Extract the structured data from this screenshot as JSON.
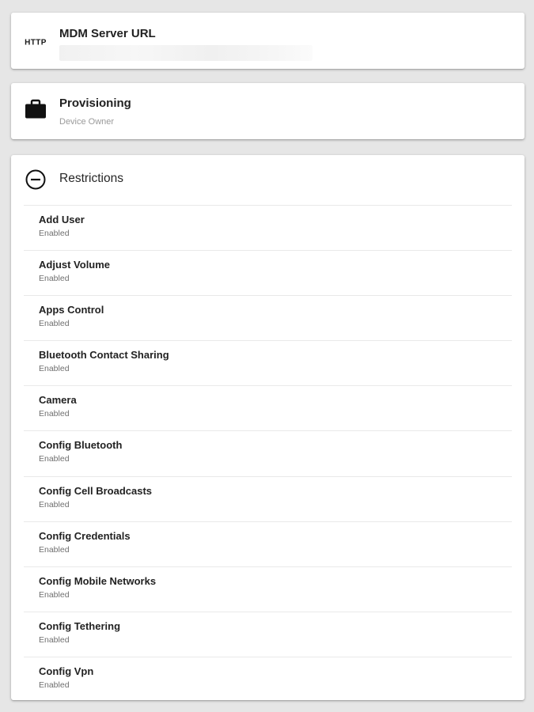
{
  "mdm_server": {
    "icon": "http-icon",
    "icon_text": "HTTP",
    "title": "MDM Server URL"
  },
  "provisioning": {
    "icon": "briefcase-icon",
    "title": "Provisioning",
    "subtitle": "Device Owner"
  },
  "restrictions": {
    "icon": "collapse-icon",
    "title": "Restrictions",
    "items": [
      {
        "label": "Add User",
        "status": "Enabled"
      },
      {
        "label": "Adjust Volume",
        "status": "Enabled"
      },
      {
        "label": "Apps Control",
        "status": "Enabled"
      },
      {
        "label": "Bluetooth Contact Sharing",
        "status": "Enabled"
      },
      {
        "label": "Camera",
        "status": "Enabled"
      },
      {
        "label": "Config Bluetooth",
        "status": "Enabled"
      },
      {
        "label": "Config Cell Broadcasts",
        "status": "Enabled"
      },
      {
        "label": "Config Credentials",
        "status": "Enabled"
      },
      {
        "label": "Config Mobile Networks",
        "status": "Enabled"
      },
      {
        "label": "Config Tethering",
        "status": "Enabled"
      },
      {
        "label": "Config Vpn",
        "status": "Enabled"
      }
    ]
  },
  "colors": {
    "background": "#e6e6e6",
    "card": "#ffffff",
    "text_primary": "#222222",
    "text_secondary": "#9a9a9a"
  }
}
